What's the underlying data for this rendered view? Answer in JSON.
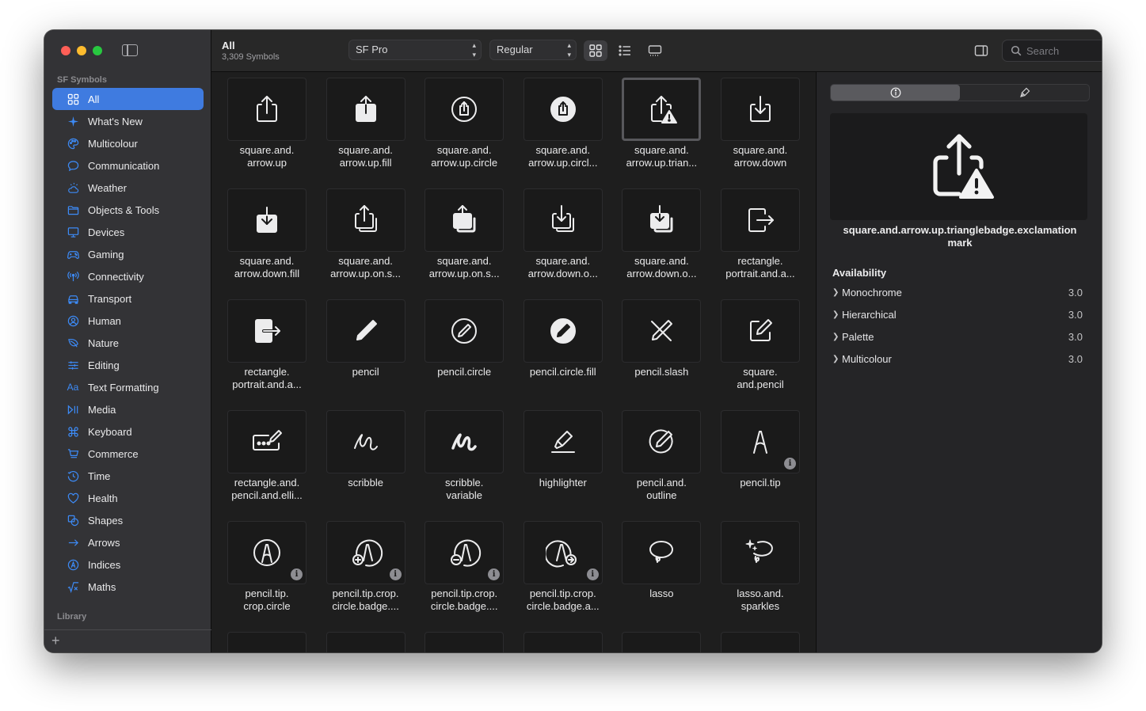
{
  "sidebar": {
    "section_title": "SF Symbols",
    "library_title": "Library",
    "add_label": "+",
    "items": [
      {
        "label": "All",
        "icon": "grid-icon",
        "active": true
      },
      {
        "label": "What's New",
        "icon": "sparkle-icon"
      },
      {
        "label": "Multicolour",
        "icon": "palette-icon"
      },
      {
        "label": "Communication",
        "icon": "message-icon"
      },
      {
        "label": "Weather",
        "icon": "cloud-sun-icon"
      },
      {
        "label": "Objects & Tools",
        "icon": "folder-icon"
      },
      {
        "label": "Devices",
        "icon": "display-icon"
      },
      {
        "label": "Gaming",
        "icon": "gamecontroller-icon"
      },
      {
        "label": "Connectivity",
        "icon": "antenna-icon"
      },
      {
        "label": "Transport",
        "icon": "car-icon"
      },
      {
        "label": "Human",
        "icon": "person-icon"
      },
      {
        "label": "Nature",
        "icon": "leaf-icon"
      },
      {
        "label": "Editing",
        "icon": "slider-icon"
      },
      {
        "label": "Text Formatting",
        "icon": "textformat-icon"
      },
      {
        "label": "Media",
        "icon": "playpause-icon"
      },
      {
        "label": "Keyboard",
        "icon": "command-icon"
      },
      {
        "label": "Commerce",
        "icon": "cart-icon"
      },
      {
        "label": "Time",
        "icon": "clock-icon"
      },
      {
        "label": "Health",
        "icon": "heart-icon"
      },
      {
        "label": "Shapes",
        "icon": "shapes-icon"
      },
      {
        "label": "Arrows",
        "icon": "arrow-right-icon"
      },
      {
        "label": "Indices",
        "icon": "a-circle-icon"
      },
      {
        "label": "Maths",
        "icon": "sqrt-icon"
      }
    ]
  },
  "toolbar": {
    "title": "All",
    "subtitle": "3,309 Symbols",
    "font_popup": "SF Pro",
    "weight_popup": "Regular",
    "search_placeholder": "Search"
  },
  "grid": [
    {
      "name": "square.and.\narrow.up",
      "icon": "share-icon"
    },
    {
      "name": "square.and.\narrow.up.fill",
      "icon": "share-fill-icon"
    },
    {
      "name": "square.and.\narrow.up.circle",
      "icon": "share-circle-icon"
    },
    {
      "name": "square.and.\narrow.up.circl...",
      "icon": "share-circle-fill-icon"
    },
    {
      "name": "square.and.\narrow.up.trian...",
      "icon": "share-warning-icon",
      "selected": true
    },
    {
      "name": "square.and.\narrow.down",
      "icon": "download-icon"
    },
    {
      "name": "square.and.\narrow.down.fill",
      "icon": "download-fill-icon"
    },
    {
      "name": "square.and.\narrow.up.on.s...",
      "icon": "share-stack-icon"
    },
    {
      "name": "square.and.\narrow.up.on.s...",
      "icon": "share-stack-fill-icon"
    },
    {
      "name": "square.and.\narrow.down.o...",
      "icon": "download-stack-icon"
    },
    {
      "name": "square.and.\narrow.down.o...",
      "icon": "download-stack-fill-icon"
    },
    {
      "name": "rectangle.\nportrait.and.a...",
      "icon": "portrait-arrow-icon"
    },
    {
      "name": "rectangle.\nportrait.and.a...",
      "icon": "portrait-arrow-fill-icon"
    },
    {
      "name": "pencil",
      "icon": "pencil-icon"
    },
    {
      "name": "pencil.circle",
      "icon": "pencil-circle-icon"
    },
    {
      "name": "pencil.circle.fill",
      "icon": "pencil-circle-fill-icon"
    },
    {
      "name": "pencil.slash",
      "icon": "pencil-slash-icon"
    },
    {
      "name": "square.\nand.pencil",
      "icon": "square-pencil-icon"
    },
    {
      "name": "rectangle.and.\npencil.and.elli...",
      "icon": "rect-pencil-ellipsis-icon"
    },
    {
      "name": "scribble",
      "icon": "scribble-icon"
    },
    {
      "name": "scribble.\nvariable",
      "icon": "scribble-variable-icon"
    },
    {
      "name": "highlighter",
      "icon": "highlighter-icon"
    },
    {
      "name": "pencil.and.\noutline",
      "icon": "pencil-outline-icon"
    },
    {
      "name": "pencil.tip",
      "icon": "pencil-tip-icon",
      "badge": "i"
    },
    {
      "name": "pencil.tip.\ncrop.circle",
      "icon": "pencil-tip-circle-icon",
      "badge": "i"
    },
    {
      "name": "pencil.tip.crop.\ncircle.badge....",
      "icon": "pencil-tip-plus-icon",
      "badge": "i"
    },
    {
      "name": "pencil.tip.crop.\ncircle.badge....",
      "icon": "pencil-tip-minus-icon",
      "badge": "i"
    },
    {
      "name": "pencil.tip.crop.\ncircle.badge.a...",
      "icon": "pencil-tip-arrow-icon",
      "badge": "i"
    },
    {
      "name": "lasso",
      "icon": "lasso-icon"
    },
    {
      "name": "lasso.and.\nsparkles",
      "icon": "lasso-sparkles-icon"
    },
    {
      "name": "",
      "icon": "trash-icon"
    },
    {
      "name": "",
      "icon": "trash-fill-icon"
    },
    {
      "name": "",
      "icon": "circle-partial-icon"
    },
    {
      "name": "",
      "icon": "circle-fill-partial-icon"
    },
    {
      "name": "",
      "icon": "rect-partial-icon"
    },
    {
      "name": "",
      "icon": "rect-fill-partial-icon"
    }
  ],
  "inspector": {
    "name": "square.and.arrow.up.trianglebadge.exclamation\nmark",
    "availability_title": "Availability",
    "availability": [
      {
        "label": "Monochrome",
        "version": "3.0"
      },
      {
        "label": "Hierarchical",
        "version": "3.0"
      },
      {
        "label": "Palette",
        "version": "3.0"
      },
      {
        "label": "Multicolour",
        "version": "3.0"
      }
    ]
  },
  "colors": {
    "accent": "#3f7be0",
    "sidebar_icon": "#3d8bf7",
    "window_bg": "#1e1e1e",
    "sidebar_bg": "#333336"
  }
}
